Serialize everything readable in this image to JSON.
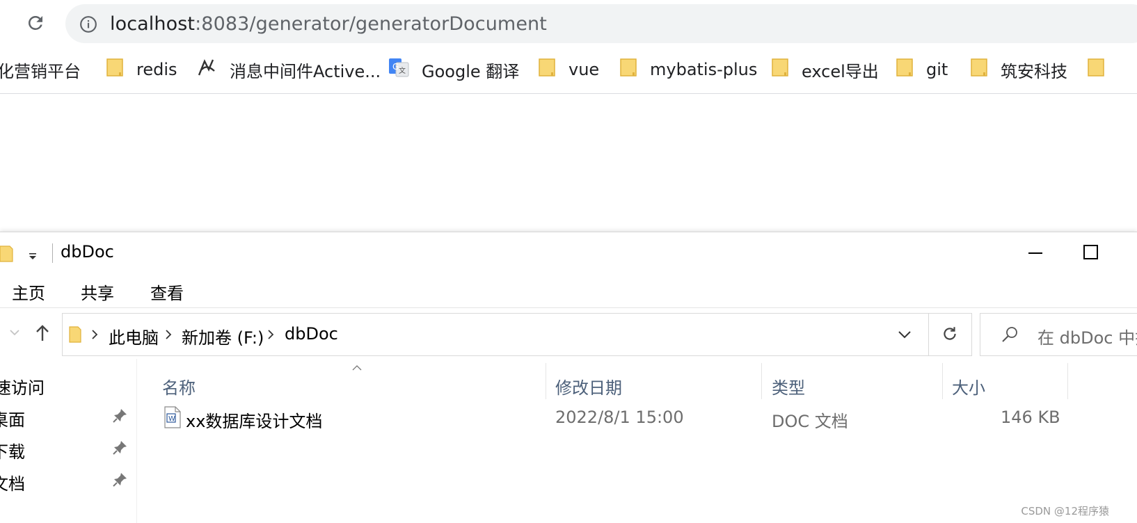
{
  "browser": {
    "url_host": "localhost",
    "url_rest": ":8083/generator/generatorDocument",
    "bookmarks": [
      {
        "label": "化营销平台",
        "icon": "none"
      },
      {
        "label": "redis",
        "icon": "folder-icon"
      },
      {
        "label": "消息中间件Active...",
        "icon": "activemq-icon"
      },
      {
        "label": "Google 翻译",
        "icon": "google-translate-icon"
      },
      {
        "label": "vue",
        "icon": "folder-icon"
      },
      {
        "label": "mybatis-plus",
        "icon": "folder-icon"
      },
      {
        "label": "excel导出",
        "icon": "folder-icon"
      },
      {
        "label": "git",
        "icon": "folder-icon"
      },
      {
        "label": "筑安科技",
        "icon": "folder-icon"
      }
    ]
  },
  "explorer": {
    "title": "dbDoc",
    "ribbon_tabs": [
      "主页",
      "共享",
      "查看"
    ],
    "breadcrumb": [
      "此电脑",
      "新加卷 (F:)",
      "dbDoc"
    ],
    "search_placeholder": "在 dbDoc 中搜",
    "quick_access": [
      {
        "label": "速访问",
        "pinned": false
      },
      {
        "label": "桌面",
        "pinned": true
      },
      {
        "label": "下载",
        "pinned": true
      },
      {
        "label": "文档",
        "pinned": true
      }
    ],
    "columns": [
      "名称",
      "修改日期",
      "类型",
      "大小"
    ],
    "files": [
      {
        "name": "xx数据库设计文档",
        "modified": "2022/8/1 15:00",
        "type": "DOC 文档",
        "size": "146 KB"
      }
    ]
  },
  "watermark": "CSDN @12程序猿",
  "colors": {
    "omnibox_bg": "#f1f3f4",
    "folder_yellow": "#f8d775",
    "column_header_text": "#4c607a"
  }
}
